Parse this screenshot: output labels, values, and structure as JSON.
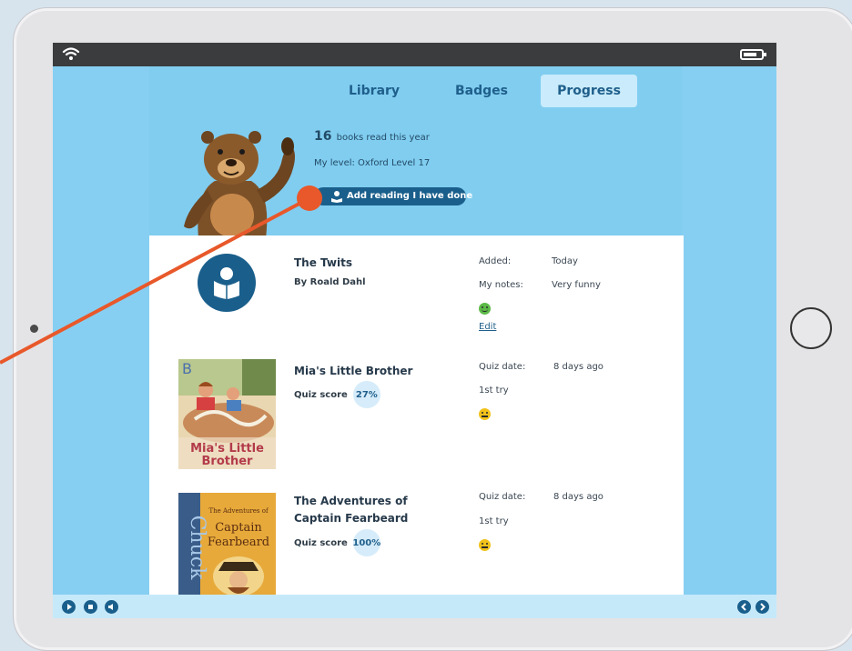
{
  "tabs": [
    {
      "label": "Library",
      "active": false
    },
    {
      "label": "Badges",
      "active": false
    },
    {
      "label": "Progress",
      "active": true
    }
  ],
  "summary": {
    "books_count": "16",
    "books_text": "books read this year",
    "level_text": "My level: Oxford Level 17"
  },
  "add_button": {
    "label": "Add reading I have done",
    "icon": "reader-icon"
  },
  "books": [
    {
      "title": "The Twits",
      "author": "By Roald Dahl",
      "cover": "reader-icon",
      "meta": [
        {
          "label": "Added:",
          "value": "Today"
        },
        {
          "label": "My notes:",
          "value": "Very funny"
        }
      ],
      "mood": "happy",
      "edit_label": "Edit"
    },
    {
      "title": "Mia's Little Brother",
      "quiz_label": "Quiz score",
      "quiz_score": "27%",
      "cover_text": "Mia's Little Brother",
      "cover_letter": "B",
      "meta": [
        {
          "label": "Quiz date:",
          "value": "8 days ago"
        },
        {
          "label": "1st try",
          "value": ""
        }
      ],
      "mood": "neutral"
    },
    {
      "title": "The Adventures of Captain Fearbeard",
      "quiz_label": "Quiz score",
      "quiz_score": "100%",
      "cover_text": "Captain Fearbeard",
      "cover_subtext": "The Adventures of",
      "cover_side_text": "Chuck",
      "meta": [
        {
          "label": "Quiz date:",
          "value": "8 days ago"
        },
        {
          "label": "1st try",
          "value": ""
        }
      ],
      "mood": "neutral"
    }
  ],
  "status_bar": {
    "icons": [
      "wifi-icon",
      "battery-icon"
    ],
    "battery_level": 0.8
  },
  "player_controls": [
    "play-icon",
    "stop-icon",
    "volume-icon",
    "prev-icon",
    "next-icon"
  ],
  "colors": {
    "screen_bg": "#86cff2",
    "dark_blue": "#1a5f8c",
    "active_tab": "#c9ebfb",
    "annotation_line": "#e8582a",
    "happy": "#5cba47",
    "neutral": "#f2c21a"
  }
}
